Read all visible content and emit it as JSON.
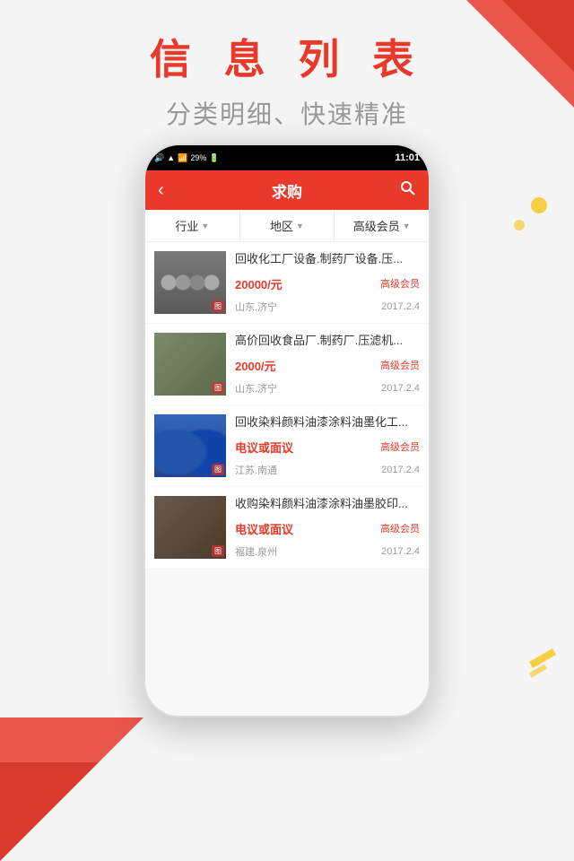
{
  "page": {
    "title": "信 息 列 表",
    "subtitle": "分类明细、快速精准"
  },
  "status_bar": {
    "signal": "🔊 ▲",
    "percent": "29%",
    "time": "11:01"
  },
  "app_header": {
    "back_label": "‹",
    "title": "求购",
    "search_icon": "🔍"
  },
  "filters": [
    {
      "label": "行业",
      "arrow": "▼"
    },
    {
      "label": "地区",
      "arrow": "▼"
    },
    {
      "label": "高级会员",
      "arrow": "▼"
    }
  ],
  "list_items": [
    {
      "title": "回收化工厂设备.制药厂设备.压...",
      "price": "20000/元",
      "badge": "高级会员",
      "location": "山东.济宁",
      "date": "2017.2.4",
      "img_type": "1"
    },
    {
      "title": "高价回收食品厂.制药厂.压滤机...",
      "price": "2000/元",
      "badge": "高级会员",
      "location": "山东.济宁",
      "date": "2017.2.4",
      "img_type": "2"
    },
    {
      "title": "回收染料颜料油漆涂料油墨化工...",
      "price": "电议或面议",
      "badge": "高级会员",
      "location": "江苏.南通",
      "date": "2017.2.4",
      "img_type": "3"
    },
    {
      "title": "收购染料颜料油漆涂料油墨胶印...",
      "price": "电议或面议",
      "badge": "高级会员",
      "location": "福建.泉州",
      "date": "2017.2.4",
      "img_type": "4"
    }
  ]
}
